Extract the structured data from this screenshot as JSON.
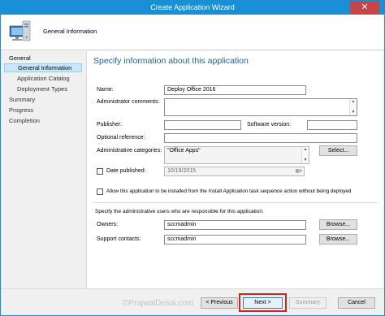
{
  "window": {
    "title": "Create Application Wizard",
    "close_glyph": "✕"
  },
  "header": {
    "title": "General Information",
    "icon": "computer-icon"
  },
  "nav": {
    "items": [
      {
        "label": "General"
      },
      {
        "label": "General Information"
      },
      {
        "label": "Application Catalog"
      },
      {
        "label": "Deployment Types"
      },
      {
        "label": "Summary"
      },
      {
        "label": "Progress"
      },
      {
        "label": "Completion"
      }
    ]
  },
  "content": {
    "heading": "Specify information about this application",
    "name": {
      "label": "Name:",
      "value": "Deploy Office 2016"
    },
    "admin_comments": {
      "label": "Administrator comments:",
      "value": ""
    },
    "publisher": {
      "label": "Publisher:",
      "value": ""
    },
    "software_version": {
      "label": "Software version:",
      "value": ""
    },
    "optional_reference": {
      "label": "Optional reference:",
      "value": ""
    },
    "admin_categories": {
      "label": "Administrative categories:",
      "value": "\"Office Apps\"",
      "select_label": "Select..."
    },
    "date_published": {
      "label": "Date published:",
      "value": "10/19/2015",
      "checked": false
    },
    "allow_install": {
      "label": "Allow this application to be installed from the Install Application task sequence action without being deployed",
      "checked": false
    },
    "users_caption": "Specify the administrative users who are responsible for this application.",
    "owners": {
      "label": "Owners:",
      "value": "sccmadmin",
      "browse_label": "Browse..."
    },
    "support_contacts": {
      "label": "Support contacts:",
      "value": "sccmadmin",
      "browse_label": "Browse..."
    }
  },
  "footer": {
    "previous_label": "< Previous",
    "next_label": "Next >",
    "summary_label": "Summary",
    "cancel_label": "Cancel",
    "watermark": "©PrajwalDesai.com"
  },
  "colors": {
    "accent": "#1a8fd6",
    "heading": "#1f5fa8",
    "highlight": "#d0251f",
    "close": "#c74545"
  }
}
